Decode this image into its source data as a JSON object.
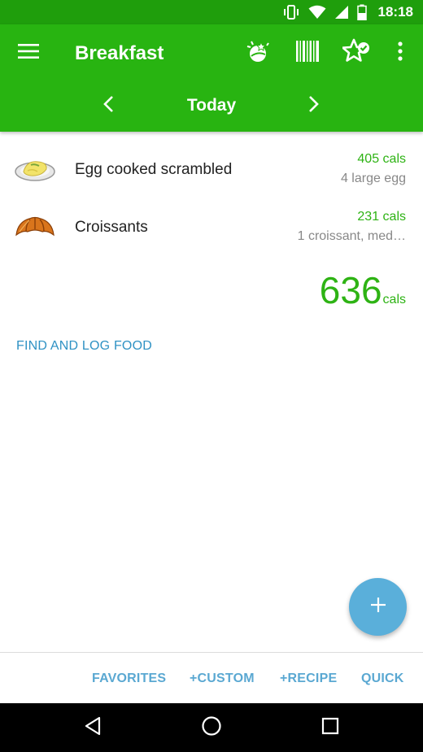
{
  "status_bar": {
    "time": "18:18",
    "icons": [
      "vibrate-icon",
      "wifi-icon",
      "signal-icon",
      "battery-icon"
    ]
  },
  "toolbar": {
    "menu_icon": "hamburger-menu-icon",
    "title": "Breakfast",
    "actions": [
      "meal-suggestion-icon",
      "barcode-icon",
      "favorite-star-check-icon",
      "more-vert-icon"
    ]
  },
  "date_nav": {
    "label": "Today",
    "prev_icon": "chevron-left-icon",
    "next_icon": "chevron-right-icon"
  },
  "foods": [
    {
      "name": "Egg cooked scrambled",
      "cals": "405 cals",
      "serving": "4 large egg",
      "image": "scrambled-egg-plate-icon"
    },
    {
      "name": "Croissants",
      "cals": "231 cals",
      "serving": "1 croissant, med…",
      "image": "croissant-icon"
    }
  ],
  "total": {
    "value": "636",
    "unit": "cals"
  },
  "find_link": "FIND AND LOG FOOD",
  "fab": {
    "icon": "plus-icon"
  },
  "bottom_actions": [
    "FAVORITES",
    "+CUSTOM",
    "+RECIPE",
    "QUICK"
  ],
  "nav": [
    "back-icon",
    "home-icon",
    "recents-icon"
  ],
  "colors": {
    "status_bar": "#1f9e0c",
    "app_bar": "#28b411",
    "calorie_green": "#2eb314",
    "link_blue": "#2f92c4",
    "fab_blue": "#5aafda",
    "action_blue": "#5aa8d2"
  }
}
